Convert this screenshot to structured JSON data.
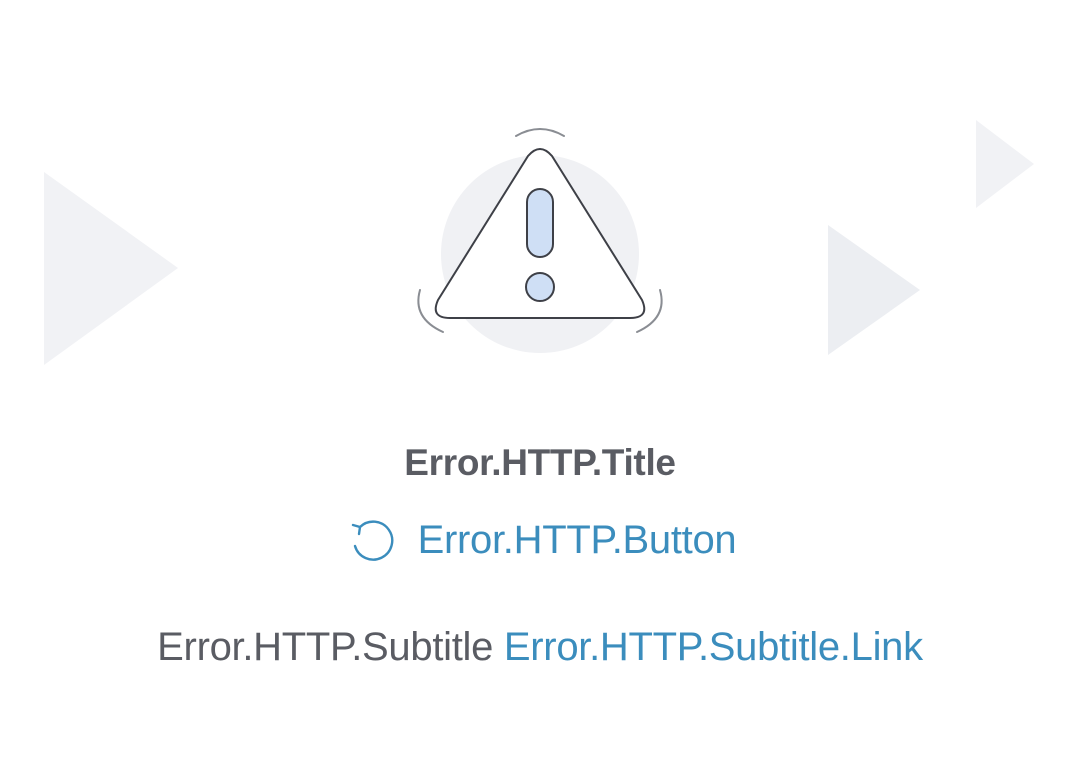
{
  "error": {
    "title": "Error.HTTP.Title",
    "button_label": "Error.HTTP.Button",
    "subtitle": "Error.HTTP.Subtitle",
    "subtitle_link": "Error.HTTP.Subtitle.Link"
  },
  "icons": {
    "illustration": "warning-triangle-icon",
    "button": "refresh-icon"
  },
  "colors": {
    "title": "#5a5c63",
    "link": "#3b8dbd",
    "decor": "#eef0f3",
    "exclamation_fill": "#cfdff5"
  }
}
